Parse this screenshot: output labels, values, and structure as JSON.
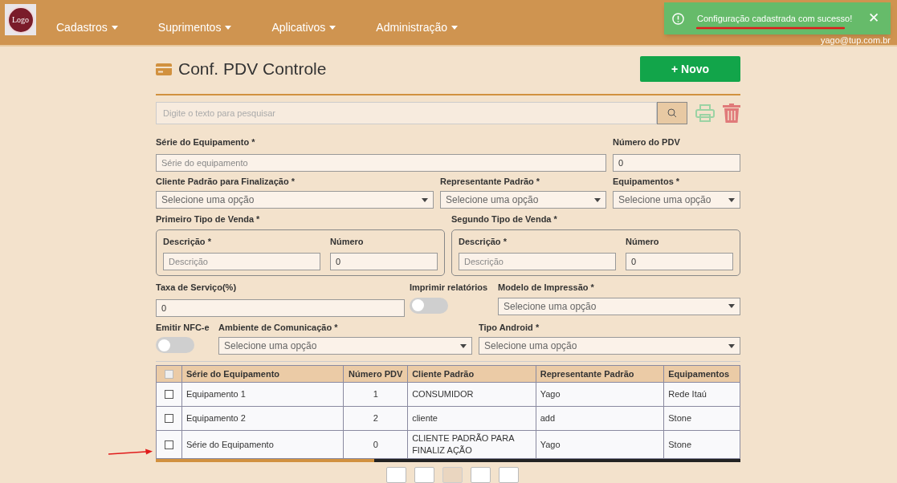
{
  "nav": {
    "logo": "Logo",
    "menus": [
      "Cadastros",
      "Suprimentos",
      "Aplicativos",
      "Administração"
    ],
    "user": "yago@tup.com.br"
  },
  "toast": {
    "message": "Configuração cadastrada com sucesso!",
    "close": "✕"
  },
  "page": {
    "title": "Conf. PDV Controle",
    "new_button": "+ Novo"
  },
  "search": {
    "placeholder": "Digite o texto para pesquisar"
  },
  "form": {
    "serie": {
      "label": "Série do Equipamento *",
      "placeholder": "Série do equipamento"
    },
    "numero_pdv": {
      "label": "Número do PDV",
      "value": "0"
    },
    "cliente": {
      "label": "Cliente Padrão para Finalização *",
      "placeholder": "Selecione uma opção"
    },
    "representante": {
      "label": "Representante Padrão *",
      "placeholder": "Selecione uma opção"
    },
    "equipamentos": {
      "label": "Equipamentos *",
      "placeholder": "Selecione uma opção"
    },
    "tipos_venda": [
      {
        "title": "Primeiro Tipo de Venda *",
        "descricao_label": "Descrição *",
        "descricao_placeholder": "Descrição",
        "numero_label": "Número",
        "numero_value": "0"
      },
      {
        "title": "Segundo Tipo de Venda *",
        "descricao_label": "Descrição *",
        "descricao_placeholder": "Descrição",
        "numero_label": "Número",
        "numero_value": "0"
      }
    ],
    "taxa": {
      "label": "Taxa de Serviço(%)",
      "value": "0"
    },
    "imprimir": {
      "label": "Imprimir relatórios",
      "on": false
    },
    "modelo": {
      "label": "Modelo de Impressão *",
      "placeholder": "Selecione uma opção"
    },
    "nfce": {
      "label": "Emitir NFC-e",
      "on": false
    },
    "ambiente": {
      "label": "Ambiente de Comunicação *",
      "placeholder": "Selecione uma opção"
    },
    "android": {
      "label": "Tipo Android *",
      "placeholder": "Selecione uma opção"
    }
  },
  "table": {
    "all_checked": false,
    "columns": [
      "Série do Equipamento",
      "Número PDV",
      "Cliente Padrão",
      "Representante Padrão",
      "Equipamentos"
    ],
    "rows": [
      {
        "checked": false,
        "cells": [
          "Equipamento 1",
          "1",
          "CONSUMIDOR",
          "Yago",
          "Rede Itaú"
        ]
      },
      {
        "checked": false,
        "cells": [
          "Equipamento 2",
          "2",
          "cliente",
          "add",
          "Stone"
        ]
      },
      {
        "checked": false,
        "cells": [
          "Série do Equipamento",
          "0",
          "CLIENTE PADRÃO PARA FINALIZ AÇÃO",
          "Yago",
          "Stone"
        ]
      }
    ]
  },
  "pagination": [
    {
      "selected": false
    },
    {
      "selected": false
    },
    {
      "selected": true
    },
    {
      "selected": false
    },
    {
      "selected": false
    }
  ]
}
